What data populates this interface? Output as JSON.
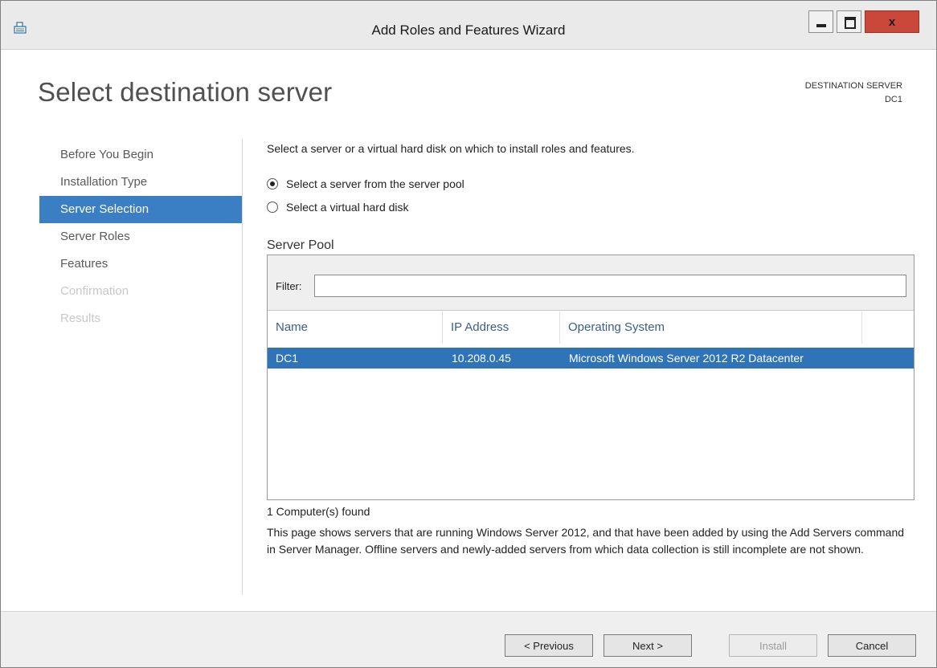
{
  "window": {
    "title": "Add Roles and Features Wizard",
    "close_glyph": "x"
  },
  "page": {
    "heading": "Select destination server",
    "destination_label": "DESTINATION SERVER",
    "destination_value": "DC1"
  },
  "nav": {
    "items": [
      {
        "label": "Before You Begin",
        "state": "normal"
      },
      {
        "label": "Installation Type",
        "state": "normal"
      },
      {
        "label": "Server Selection",
        "state": "active"
      },
      {
        "label": "Server Roles",
        "state": "normal"
      },
      {
        "label": "Features",
        "state": "normal"
      },
      {
        "label": "Confirmation",
        "state": "disabled"
      },
      {
        "label": "Results",
        "state": "disabled"
      }
    ]
  },
  "content": {
    "intro": "Select a server or a virtual hard disk on which to install roles and features.",
    "option_pool": "Select a server from the server pool",
    "option_vhd": "Select a virtual hard disk",
    "selected_option": "pool"
  },
  "pool": {
    "title": "Server Pool",
    "filter_label": "Filter:",
    "filter_value": "",
    "columns": [
      "Name",
      "IP Address",
      "Operating System"
    ],
    "rows": [
      {
        "name": "DC1",
        "ip": "10.208.0.45",
        "os": "Microsoft Windows Server 2012 R2 Datacenter",
        "selected": true
      }
    ],
    "found_text": "1 Computer(s) found"
  },
  "note": "This page shows servers that are running Windows Server 2012, and that have been added by using the Add Servers command in Server Manager. Offline servers and newly-added servers from which data collection is still incomplete are not shown.",
  "buttons": {
    "previous": "< Previous",
    "next": "Next >",
    "install": "Install",
    "cancel": "Cancel"
  },
  "colors": {
    "accent": "#3a7fc3",
    "selection": "#2f74b8",
    "close_button": "#c9483a"
  }
}
